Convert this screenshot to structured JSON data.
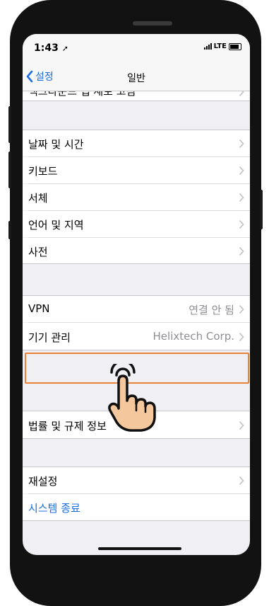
{
  "status": {
    "time": "1:43",
    "network": "LTE"
  },
  "nav": {
    "back_label": "설정",
    "title": "일반"
  },
  "partial_row": {
    "label": "백그라운드 앱 새로 고침"
  },
  "group1": [
    {
      "label": "날짜 및 시간"
    },
    {
      "label": "키보드"
    },
    {
      "label": "서체"
    },
    {
      "label": "언어 및 지역"
    },
    {
      "label": "사전"
    }
  ],
  "group2": [
    {
      "label": "VPN",
      "value": "연결 안 됨"
    },
    {
      "label": "기기 관리",
      "value": "Helixtech Corp."
    }
  ],
  "group3": [
    {
      "label": "법률 및 규제 정보"
    }
  ],
  "group4": [
    {
      "label": "재설정"
    },
    {
      "label": "시스템 종료"
    }
  ],
  "colors": {
    "accent": "#1a6fe0",
    "highlight": "#e8843a",
    "hand_fill": "#f4c79c"
  }
}
